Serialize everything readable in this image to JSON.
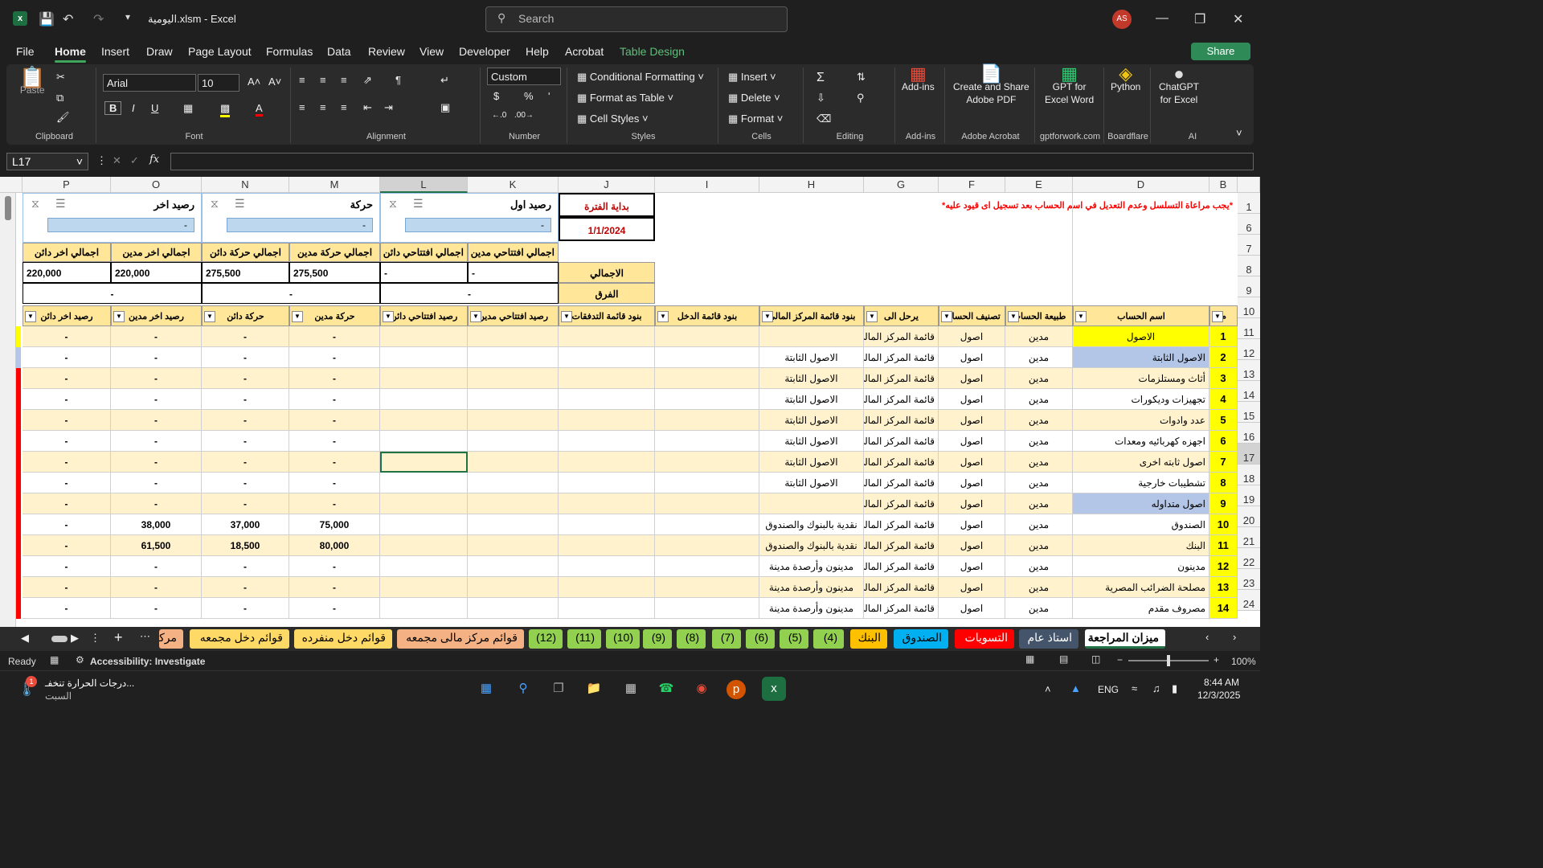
{
  "titlebar": {
    "file": "اليومية.xlsm",
    "app": "Excel",
    "search_placeholder": "Search",
    "avatar": "AS"
  },
  "menu": [
    "File",
    "Home",
    "Insert",
    "Draw",
    "Page Layout",
    "Formulas",
    "Data",
    "Review",
    "View",
    "Developer",
    "Help",
    "Acrobat",
    "Table Design"
  ],
  "share": "Share",
  "ribbon": {
    "clipboard": {
      "paste": "Paste",
      "label": "Clipboard"
    },
    "font": {
      "name": "Arial",
      "size": "10",
      "label": "Font",
      "bold": "B",
      "italic": "I",
      "underline": "U"
    },
    "alignment": {
      "label": "Alignment"
    },
    "number": {
      "format": "Custom",
      "label": "Number",
      "currency": "$",
      "percent": "%"
    },
    "styles": {
      "cf": "Conditional Formatting",
      "fat": "Format as Table",
      "cs": "Cell Styles",
      "label": "Styles"
    },
    "cells": {
      "insert": "Insert",
      "delete": "Delete",
      "format": "Format",
      "label": "Cells"
    },
    "editing": {
      "label": "Editing"
    },
    "addins": {
      "btn": "Add-ins",
      "label": "Add-ins"
    },
    "acrobat": {
      "btn1": "Create and Share",
      "btn2": "Adobe PDF",
      "label": "Adobe Acrobat"
    },
    "gptword": {
      "btn1": "GPT for",
      "btn2": "Excel Word",
      "label": "gptforwork.com"
    },
    "python": {
      "btn": "Python",
      "label": "Boardflare"
    },
    "chatgpt": {
      "btn1": "ChatGPT",
      "btn2": "for Excel",
      "label": "AI"
    }
  },
  "namebox": "L17",
  "columns": [
    "P",
    "O",
    "N",
    "M",
    "L",
    "K",
    "J",
    "I",
    "H",
    "G",
    "F",
    "E",
    "D",
    "B"
  ],
  "row_numbers": [
    "1",
    "6",
    "7",
    "8",
    "9",
    "10",
    "11",
    "12",
    "13",
    "14",
    "15",
    "16",
    "17",
    "18",
    "19",
    "20",
    "21",
    "22",
    "23",
    "24"
  ],
  "top": {
    "warning": "*يجب مراعاة التسلسل وعدم التعديل في اسم الحساب بعد تسجيل اى قيود عليه*",
    "period_start": "بداية الفترة",
    "period_date": "1/1/2024",
    "slicers": [
      {
        "title": "رصيد اخر",
        "item": "-"
      },
      {
        "title": "حركة",
        "item": "-"
      },
      {
        "title": "رصيد اول",
        "item": "-"
      }
    ],
    "totals_headers": [
      "اجمالي اخر دائن",
      "اجمالي اخر مدين",
      "اجمالي حركة دائن",
      "اجمالي حركة مدين",
      "اجمالي افتتاحي دائن",
      "اجمالي افتتاحي مدين"
    ],
    "totals_values": [
      "220,000",
      "220,000",
      "275,500",
      "275,500",
      "-",
      "-"
    ],
    "total_label": "الاجمالي",
    "diff_label": "الفرق",
    "diff_values": [
      "-",
      "-",
      "-"
    ]
  },
  "table": {
    "headers": [
      "رصيد اخر دائن",
      "رصيد اخر مدين",
      "حركة دائن",
      "حركة مدين",
      "رصيد افتتاحي دائن",
      "رصيد افتتاحي مدين",
      "بنود قائمة التدفقات",
      "بنود قائمة الدخل",
      "بنود قائمة المركز المالي",
      "يرحل الى",
      "تصنيف الحساب",
      "طبيعة الحساب",
      "اسم الحساب",
      "م"
    ],
    "rows": [
      {
        "p": "-",
        "o": "-",
        "n": "-",
        "m": "-",
        "h": "",
        "g": "قائمة المركز المالي",
        "f": "اصول",
        "e": "مدين",
        "d": "الاصول",
        "b": "1"
      },
      {
        "p": "-",
        "o": "-",
        "n": "-",
        "m": "-",
        "h": "الاصول الثابتة",
        "g": "قائمة المركز المالي",
        "f": "اصول",
        "e": "مدين",
        "d": "الاصول الثابتة",
        "b": "2"
      },
      {
        "p": "-",
        "o": "-",
        "n": "-",
        "m": "-",
        "h": "الاصول الثابتة",
        "g": "قائمة المركز المالي",
        "f": "اصول",
        "e": "مدين",
        "d": "أثاث ومستلزمات",
        "b": "3"
      },
      {
        "p": "-",
        "o": "-",
        "n": "-",
        "m": "-",
        "h": "الاصول الثابتة",
        "g": "قائمة المركز المالي",
        "f": "اصول",
        "e": "مدين",
        "d": "تجهيزات وديكورات",
        "b": "4"
      },
      {
        "p": "-",
        "o": "-",
        "n": "-",
        "m": "-",
        "h": "الاصول الثابتة",
        "g": "قائمة المركز المالي",
        "f": "اصول",
        "e": "مدين",
        "d": "عدد وادوات",
        "b": "5"
      },
      {
        "p": "-",
        "o": "-",
        "n": "-",
        "m": "-",
        "h": "الاصول الثابتة",
        "g": "قائمة المركز المالي",
        "f": "اصول",
        "e": "مدين",
        "d": "اجهزه كهربائيه ومعدات",
        "b": "6"
      },
      {
        "p": "-",
        "o": "-",
        "n": "-",
        "m": "-",
        "h": "الاصول الثابتة",
        "g": "قائمة المركز المالي",
        "f": "اصول",
        "e": "مدين",
        "d": "اصول ثابته اخرى",
        "b": "7"
      },
      {
        "p": "-",
        "o": "-",
        "n": "-",
        "m": "-",
        "h": "الاصول الثابتة",
        "g": "قائمة المركز المالي",
        "f": "اصول",
        "e": "مدين",
        "d": "تشطيبات خارجية",
        "b": "8"
      },
      {
        "p": "-",
        "o": "-",
        "n": "-",
        "m": "-",
        "h": "",
        "g": "قائمة المركز المالي",
        "f": "اصول",
        "e": "مدين",
        "d": "اصول متداوله",
        "b": "9"
      },
      {
        "p": "-",
        "o": "38,000",
        "n": "37,000",
        "m": "75,000",
        "h": "نقدية بالبنوك والصندوق",
        "g": "قائمة المركز المالي",
        "f": "اصول",
        "e": "مدين",
        "d": "الصندوق",
        "b": "10"
      },
      {
        "p": "-",
        "o": "61,500",
        "n": "18,500",
        "m": "80,000",
        "h": "نقدية بالبنوك والصندوق",
        "g": "قائمة المركز المالي",
        "f": "اصول",
        "e": "مدين",
        "d": "البنك",
        "b": "11"
      },
      {
        "p": "-",
        "o": "-",
        "n": "-",
        "m": "-",
        "h": "مدينون وأرصدة مدينة",
        "g": "قائمة المركز المالي",
        "f": "اصول",
        "e": "مدين",
        "d": "مدينون",
        "b": "12"
      },
      {
        "p": "-",
        "o": "-",
        "n": "-",
        "m": "-",
        "h": "مدينون وأرصدة مدينة",
        "g": "قائمة المركز المالي",
        "f": "اصول",
        "e": "مدين",
        "d": "مصلحة الضرائب المصرية",
        "b": "13"
      },
      {
        "p": "-",
        "o": "-",
        "n": "-",
        "m": "-",
        "h": "مدينون وأرصدة مدينة",
        "g": "قائمة المركز المالي",
        "f": "اصول",
        "e": "مدين",
        "d": "مصروف مقدم",
        "b": "14"
      }
    ]
  },
  "tabs": [
    "مركز",
    "قوائم دخل مجمعه",
    "قوائم دخل منفرده",
    "قوائم مركز مالى مجمعه",
    "(12)",
    "(11)",
    "(10)",
    "(9)",
    "(8)",
    "(7)",
    "(6)",
    "(5)",
    "(4)",
    "البنك",
    "الصندوق",
    "التسويات",
    "استاذ عام",
    "ميزان المراجعة"
  ],
  "status": {
    "ready": "Ready",
    "accessibility": "Accessibility: Investigate",
    "zoom": "100%"
  },
  "taskbar": {
    "weather1": "درجات الحرارة تنخفـ...",
    "weather2": "السبت",
    "badge": "1",
    "lang": "ENG",
    "time": "8:44 AM",
    "date": "12/3/2025"
  },
  "colors": {
    "accent": "#217346",
    "header_yellow": "#ffe699",
    "row_yellow": "#fff2cc",
    "highlight": "#ffff00",
    "blue": "#b4c6e7",
    "red": "#ff0000"
  }
}
